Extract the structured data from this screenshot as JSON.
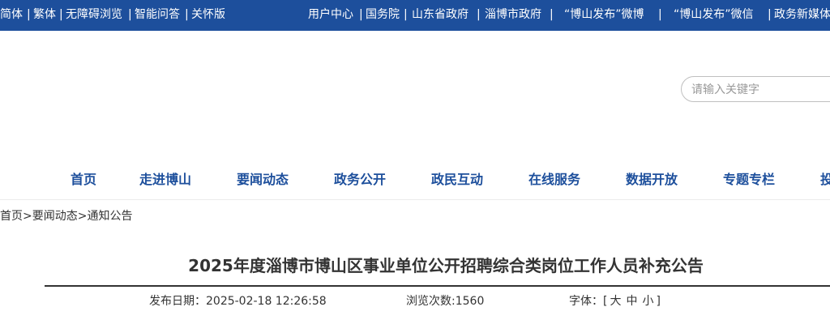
{
  "topbar": {
    "left_links": [
      "简体",
      "繁体",
      "无障碍浏览",
      "智能问答",
      "关怀版"
    ],
    "right_links": [
      "用户中心",
      "国务院",
      "山东省政府",
      "淄博市政府",
      "“博山发布”微博",
      "“博山发布”微信",
      "政务新媒体"
    ]
  },
  "search": {
    "placeholder": "请输入关键字"
  },
  "nav": [
    "首页",
    "走进博山",
    "要闻动态",
    "政务公开",
    "政民互动",
    "在线服务",
    "数据开放",
    "专题专栏",
    "投"
  ],
  "breadcrumb": {
    "home": "首页",
    "sep1": ">",
    "section": "要闻动态",
    "sep2": ">",
    "current": "通知公告"
  },
  "article": {
    "title": "2025年度淄博市博山区事业单位公开招聘综合类岗位工作人员补充公告",
    "publish_label": "发布日期：",
    "publish_date": "2025-02-18 12:26:58",
    "views_label": "浏览次数:",
    "views": "1560",
    "font_label": "字体：",
    "font_open": "[",
    "font_large": "大",
    "font_medium": "中",
    "font_small": "小",
    "font_close": "]"
  },
  "colors": {
    "topbar_bg": "#1d4f9c",
    "nav_text": "#1d4f9c"
  }
}
